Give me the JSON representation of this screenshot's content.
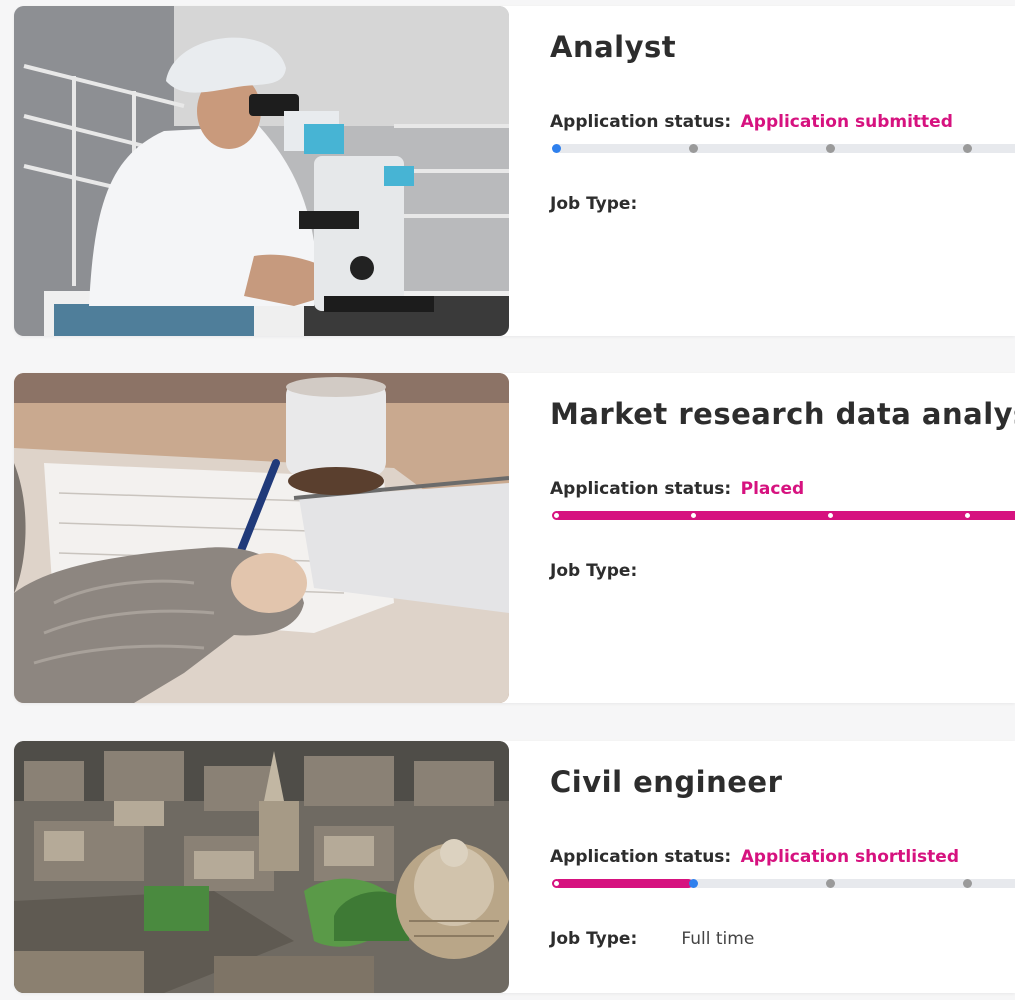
{
  "jobs": [
    {
      "title": "Analyst",
      "status_label": "Application status:",
      "status_value": "Application submitted",
      "progress_step": 1,
      "progress_steps_visible": 4,
      "job_type_label": "Job Type:",
      "job_type_value": "",
      "image": "scientist-with-microscope"
    },
    {
      "title": "Market research data analyst",
      "status_label": "Application status:",
      "status_value": "Placed",
      "progress_step": 5,
      "progress_steps_visible": 4,
      "job_type_label": "Job Type:",
      "job_type_value": "",
      "image": "hand-writing-on-paper"
    },
    {
      "title": "Civil engineer",
      "status_label": "Application status:",
      "status_value": "Application shortlisted",
      "progress_step": 2,
      "progress_steps_visible": 4,
      "job_type_label": "Job Type:",
      "job_type_value": "Full time",
      "image": "aerial-city-view"
    }
  ],
  "colors": {
    "accent": "#d6127f",
    "current_step": "#2f80ed",
    "pending_step": "#9a9a9a",
    "track": "#e7e9ed"
  }
}
